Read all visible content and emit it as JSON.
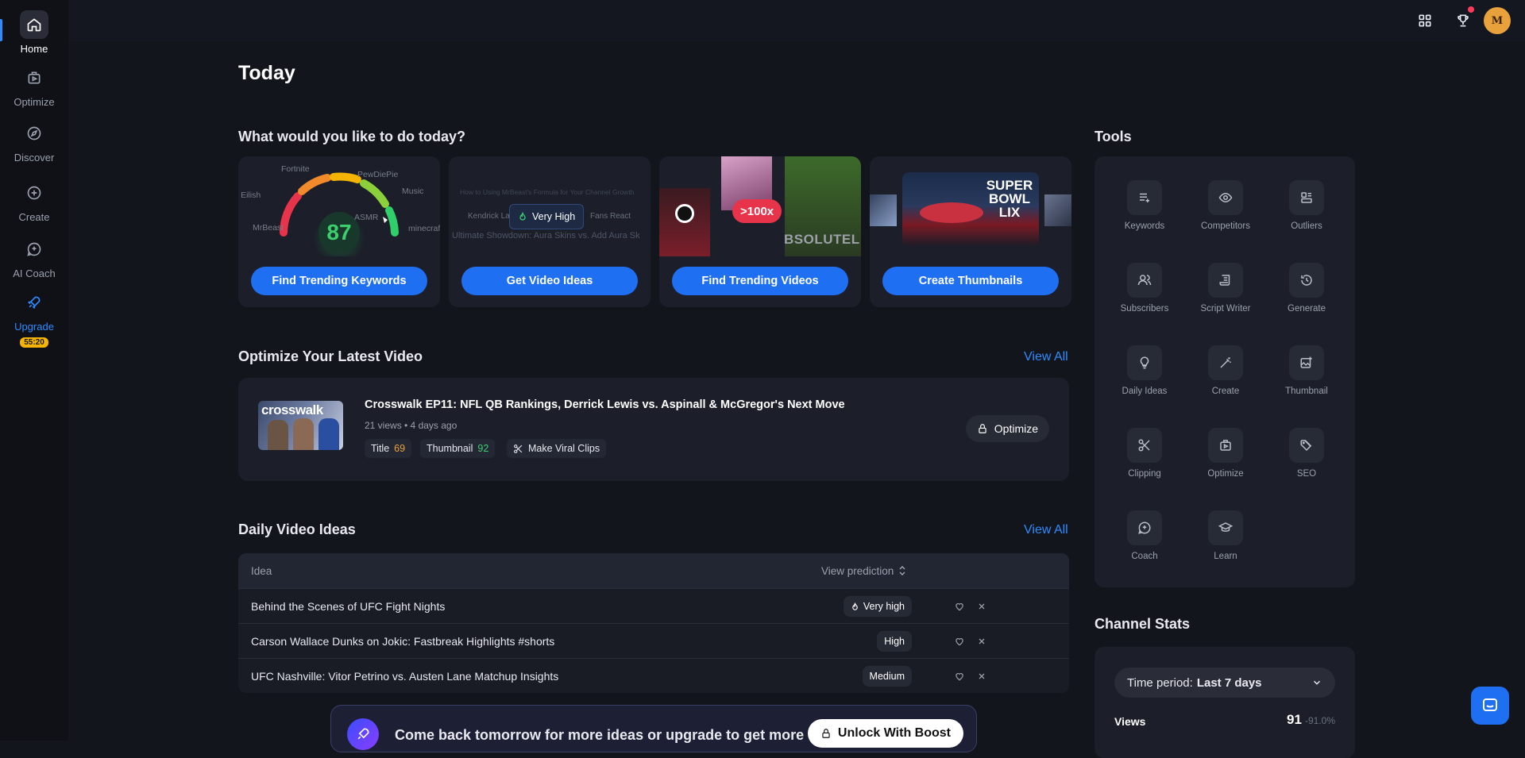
{
  "sidebar": {
    "items": [
      {
        "label": "Home",
        "icon": "home-icon"
      },
      {
        "label": "Optimize",
        "icon": "optimize-icon"
      },
      {
        "label": "Discover",
        "icon": "compass-icon"
      },
      {
        "label": "Create",
        "icon": "plus-circle-icon"
      },
      {
        "label": "AI Coach",
        "icon": "coach-icon"
      },
      {
        "label": "Upgrade",
        "icon": "rocket-icon"
      }
    ],
    "timer": "55:20"
  },
  "topbar": {
    "avatar_initials": "M",
    "icons": [
      "grid-icon",
      "trophy-icon"
    ]
  },
  "page": {
    "title": "Today"
  },
  "actions": {
    "title": "What would you like to do today?",
    "cards": [
      {
        "button": "Find Trending Keywords",
        "gauge_value": "87",
        "keywords": [
          "Fortnite",
          "MrBeast",
          "Billie Eilish",
          "ASMR",
          "PewDiePie",
          "Music",
          "minecraft"
        ]
      },
      {
        "button": "Get Video Ideas",
        "badge": "Very High",
        "snippets": [
          "Kendrick La",
          "Fans React",
          "Ultimate Showdown: Aura Skins vs. Add Aura Sk",
          "How to Using MrBeast's Formula for Your Channel Growth"
        ]
      },
      {
        "button": "Find Trending Videos",
        "badge": ">100x",
        "overlay_text": "BSOLUTEL"
      },
      {
        "button": "Create Thumbnails",
        "overlay_text": "SUPER BOWL LIX"
      }
    ]
  },
  "latest": {
    "title": "Optimize Your Latest Video",
    "view_all": "View All",
    "video": {
      "thumb_text": "crosswalk",
      "title": "Crosswalk EP11: NFL QB Rankings, Derrick Lewis vs. Aspinall & McGregor's Next Move",
      "meta": "21 views • 4 days ago",
      "title_label": "Title",
      "title_score": "69",
      "thumb_label": "Thumbnail",
      "thumb_score": "92",
      "clips_label": "Make Viral Clips",
      "optimize_label": "Optimize"
    }
  },
  "ideas": {
    "title": "Daily Video Ideas",
    "view_all": "View All",
    "col_idea": "Idea",
    "col_prediction": "View prediction",
    "rows": [
      {
        "idea": "Behind the Scenes of UFC Fight Nights",
        "prediction": "Very high"
      },
      {
        "idea": "Carson Wallace Dunks on Jokic: Fastbreak Highlights #shorts",
        "prediction": "High"
      },
      {
        "idea": "UFC Nashville: Vitor Petrino vs. Austen Lane Matchup Insights",
        "prediction": "Medium"
      }
    ]
  },
  "boost": {
    "text": "Come back tomorrow for more ideas or upgrade to get more",
    "button": "Unlock With Boost"
  },
  "tools": {
    "title": "Tools",
    "items": [
      {
        "label": "Keywords",
        "icon": "keywords-icon"
      },
      {
        "label": "Competitors",
        "icon": "eye-icon"
      },
      {
        "label": "Outliers",
        "icon": "outliers-icon"
      },
      {
        "label": "Subscribers",
        "icon": "users-icon"
      },
      {
        "label": "Script Writer",
        "icon": "script-icon"
      },
      {
        "label": "Generate",
        "icon": "refresh-icon"
      },
      {
        "label": "Daily Ideas",
        "icon": "lightbulb-icon"
      },
      {
        "label": "Create",
        "icon": "wand-icon"
      },
      {
        "label": "Thumbnail",
        "icon": "image-plus-icon"
      },
      {
        "label": "Clipping",
        "icon": "scissors-icon"
      },
      {
        "label": "Optimize",
        "icon": "optimize-icon"
      },
      {
        "label": "SEO",
        "icon": "tags-icon"
      },
      {
        "label": "Coach",
        "icon": "coach-icon"
      },
      {
        "label": "Learn",
        "icon": "graduation-cap-icon"
      }
    ]
  },
  "stats": {
    "title": "Channel Stats",
    "period_label": "Time period:",
    "period_value": "Last 7 days",
    "views_label": "Views",
    "views_value": "91",
    "views_change": "-91.0%"
  },
  "colors": {
    "accent": "#1f6ff2",
    "link": "#2f8bff",
    "title_score": "#e9a23b",
    "thumb_score": "#3ccf6e",
    "timer_badge": "#f5b400"
  }
}
